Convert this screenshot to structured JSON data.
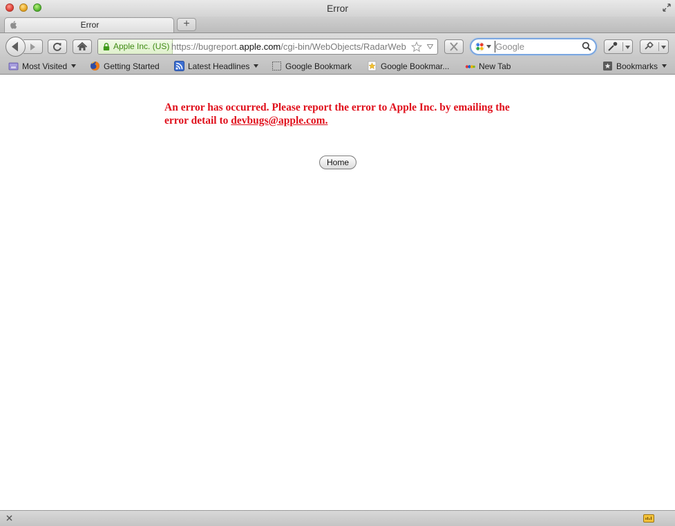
{
  "window": {
    "title": "Error"
  },
  "tab": {
    "label": "Error"
  },
  "newtab_label": "+",
  "urlbar": {
    "identity": "Apple Inc. (US)",
    "url_prefix": "https://bugreport.",
    "url_host": "apple.com",
    "url_suffix": "/cgi-bin/WebObjects/RadarWeb.woa"
  },
  "search": {
    "placeholder": "Google"
  },
  "bookmarks": {
    "items": [
      {
        "label": "Most Visited",
        "icon": "folder-icon"
      },
      {
        "label": "Getting Started",
        "icon": "firefox-icon"
      },
      {
        "label": "Latest Headlines",
        "icon": "rss-icon"
      },
      {
        "label": "Google Bookmark",
        "icon": "dotted-page-icon"
      },
      {
        "label": "Google Bookmar...",
        "icon": "star-page-icon"
      },
      {
        "label": "New Tab",
        "icon": "ebay-icon"
      }
    ],
    "bookmarks_menu": "Bookmarks"
  },
  "content": {
    "error_text": "An error has occurred. Please report the error to Apple Inc. by emailing the error detail to ",
    "error_email": "devbugs@apple.com.",
    "home_button": "Home"
  },
  "colors": {
    "error_red": "#e0101c",
    "identity_green": "#3f8a14",
    "search_focus": "#7aa6e0"
  }
}
